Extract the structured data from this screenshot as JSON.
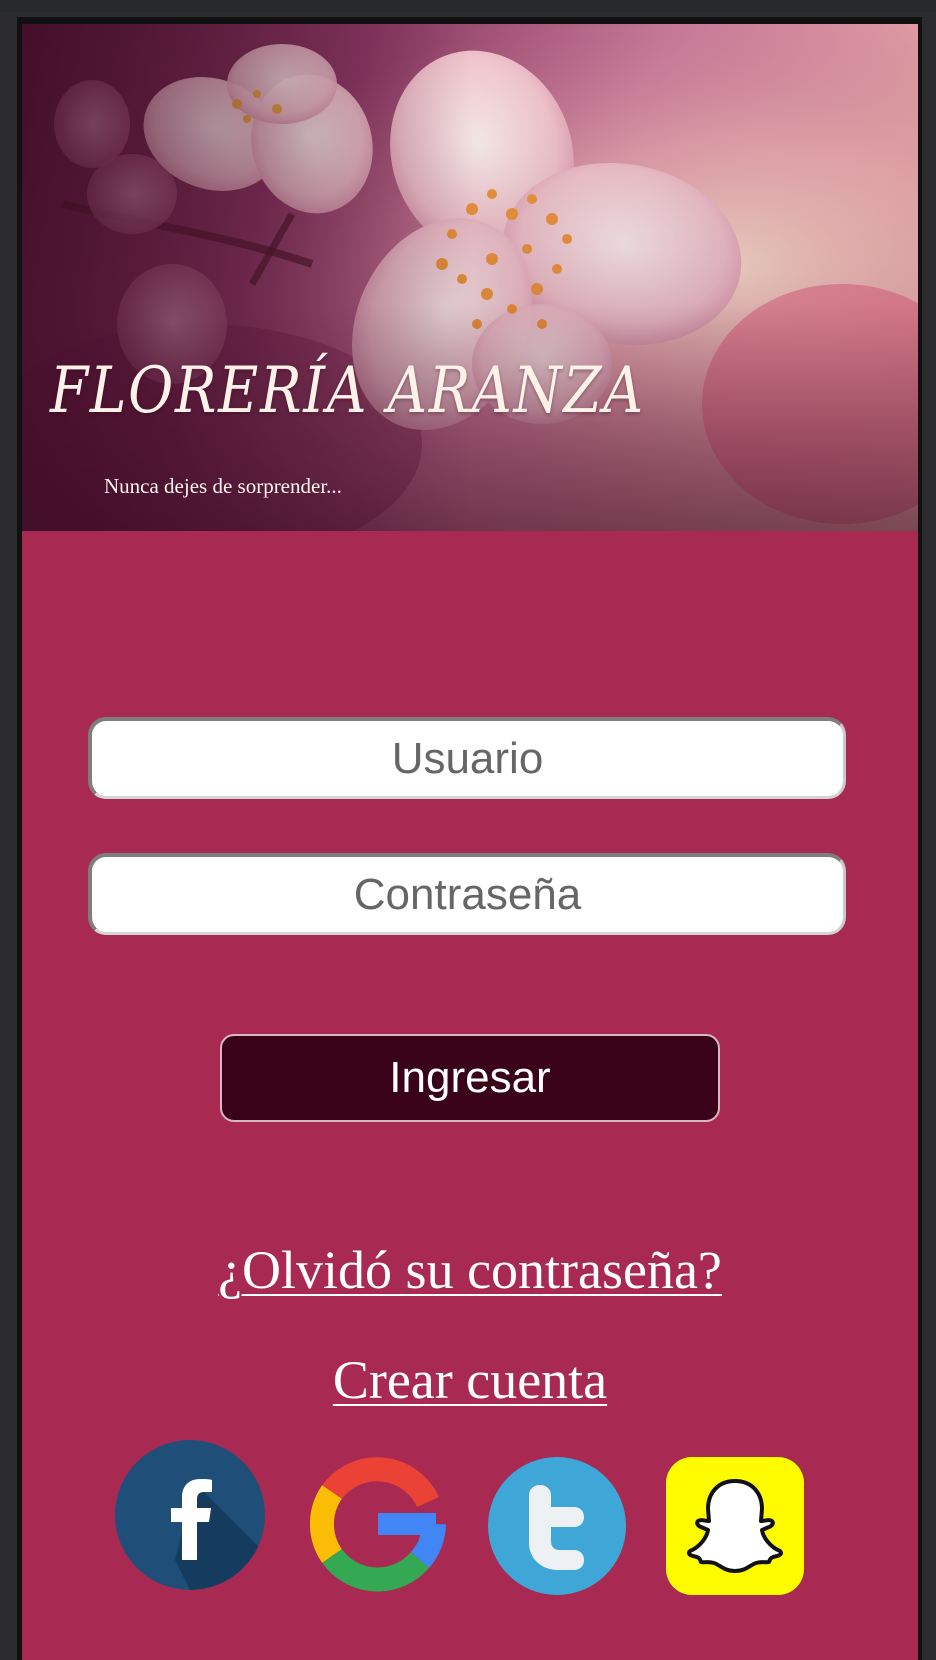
{
  "app": {
    "brand_title": "FLORERÍA ARANZA",
    "tagline": "Nunca dejes de sorprender...",
    "background_color": "#a82a52"
  },
  "login_form": {
    "username_placeholder": "Usuario",
    "password_placeholder": "Contraseña",
    "submit_label": "Ingresar",
    "submit_color": "#3a0219"
  },
  "links": {
    "forgot_password": "¿Olvidó su contraseña?",
    "create_account": "Crear cuenta"
  },
  "social": [
    {
      "name": "facebook",
      "icon": "facebook-icon",
      "color": "#1f4e79"
    },
    {
      "name": "google",
      "icon": "google-icon",
      "color": "#4285f4"
    },
    {
      "name": "twitter",
      "icon": "twitter-icon",
      "color": "#3ea7d8"
    },
    {
      "name": "snapchat",
      "icon": "snapchat-icon",
      "color": "#fffc00"
    }
  ]
}
